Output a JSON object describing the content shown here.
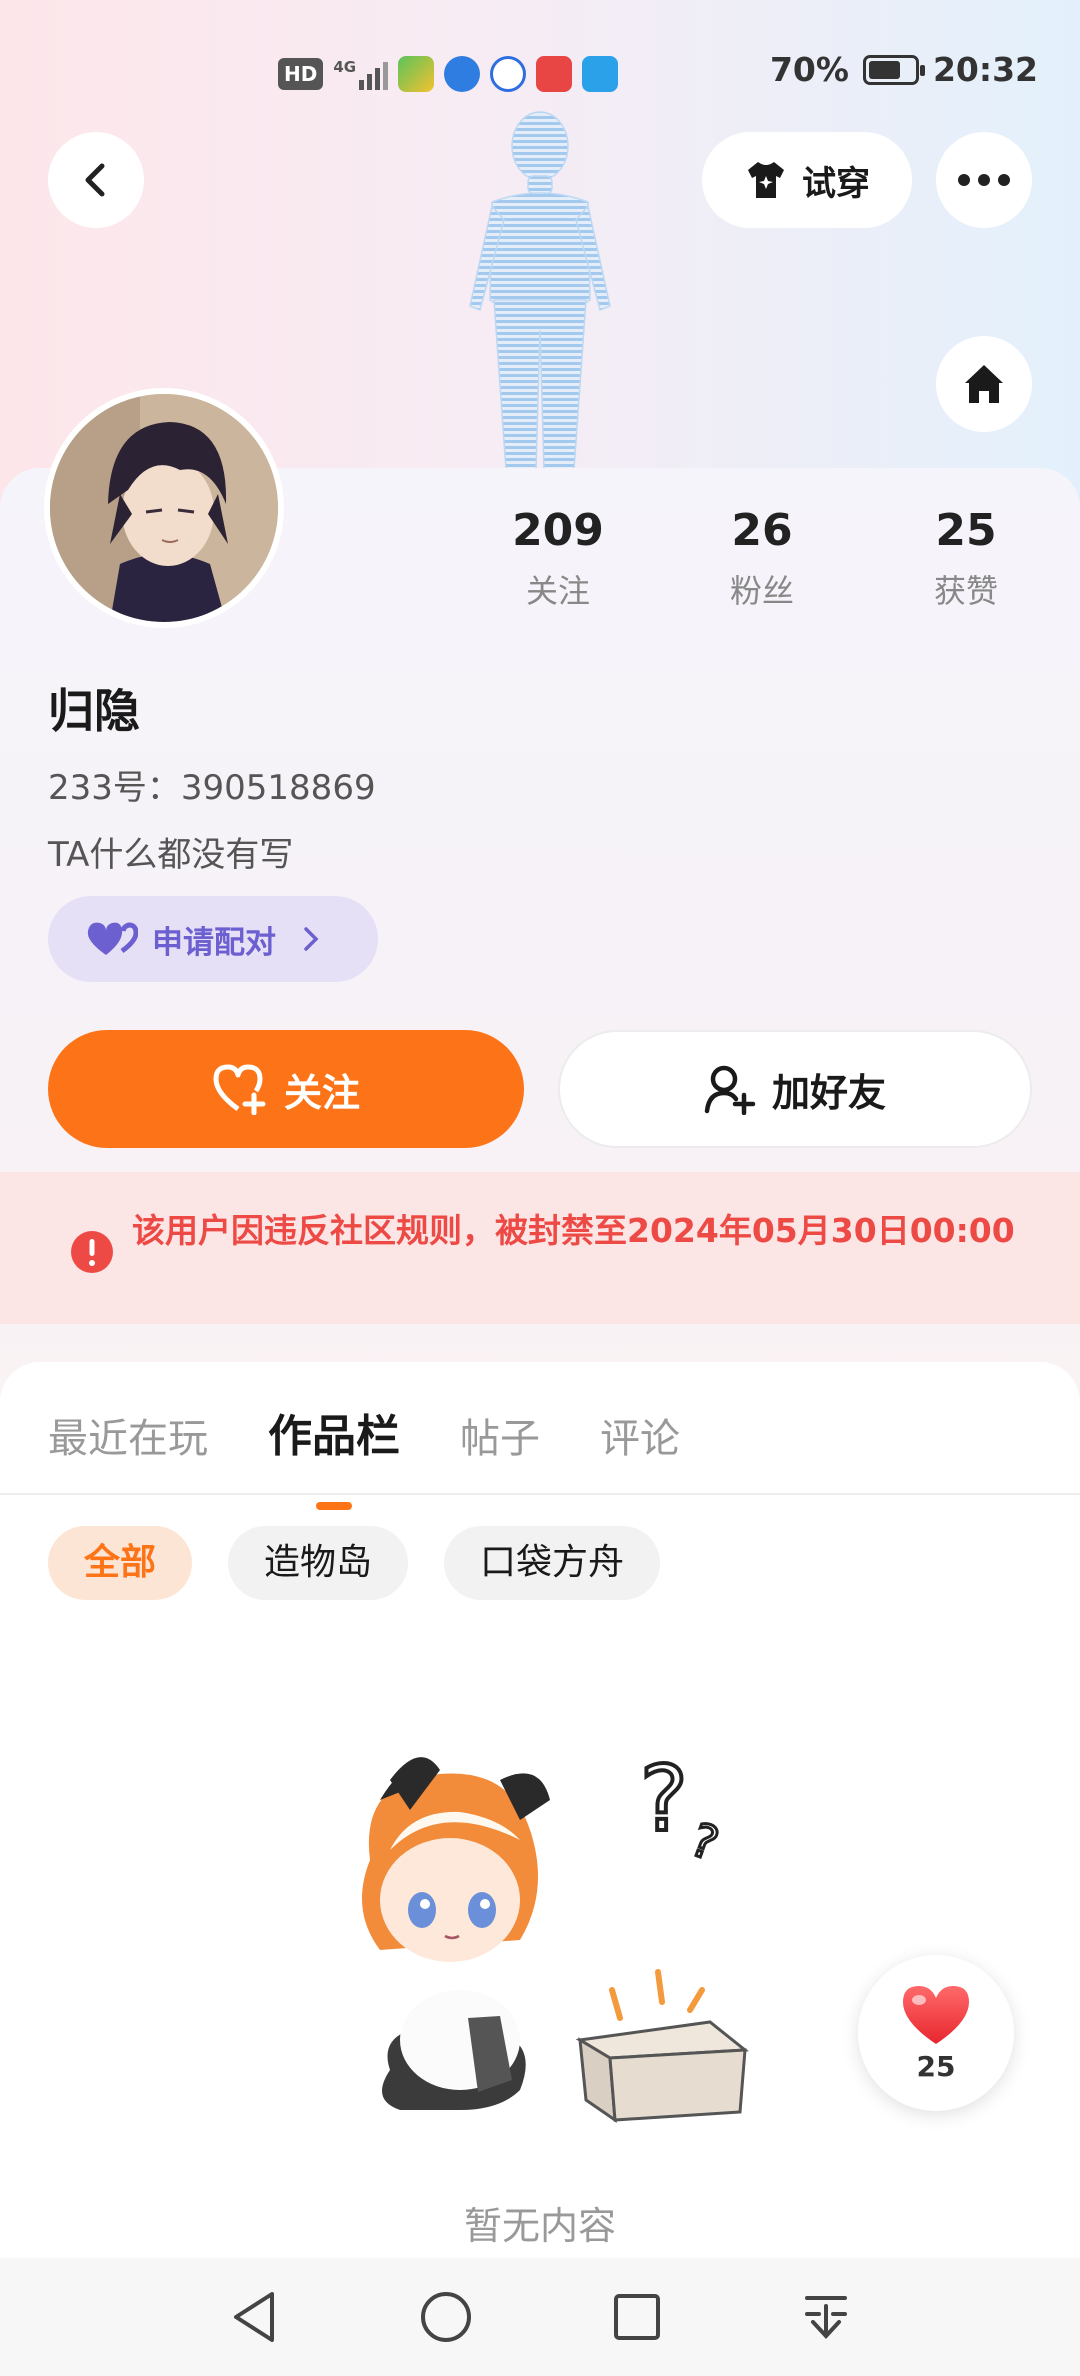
{
  "status_bar": {
    "network_badge": "HD",
    "network_type": "4G",
    "battery": "70%",
    "battery_level": 0.7,
    "time": "20:32"
  },
  "header": {
    "back_icon": "chevron-left-icon",
    "try_on_label": "试穿",
    "more_icon": "more-dots-icon",
    "home_icon": "home-icon"
  },
  "profile": {
    "name": "归隐",
    "uid": "233号：390518869",
    "bio": "TA什么都没有写",
    "pair_label": "申请配对",
    "stats": [
      {
        "num": "209",
        "label": "关注"
      },
      {
        "num": "26",
        "label": "粉丝"
      },
      {
        "num": "25",
        "label": "获赞"
      }
    ]
  },
  "actions": {
    "follow_label": "关注",
    "add_friend_label": "加好友"
  },
  "ban_notice": {
    "text": "该用户因违反社区规则，被封禁至2024年05月30日00:00",
    "color": "#ee4a45"
  },
  "tabs": [
    {
      "label": "最近在玩"
    },
    {
      "label": "作品栏"
    },
    {
      "label": "帖子"
    },
    {
      "label": "评论"
    }
  ],
  "filters": [
    {
      "label": "全部"
    },
    {
      "label": "造物岛"
    },
    {
      "label": "口袋方舟"
    }
  ],
  "empty_state": {
    "text": "暂无内容"
  },
  "like_float": {
    "count": "25"
  },
  "theme": {
    "accent": "#fd7418",
    "pair_color": "#6c5fd0"
  }
}
